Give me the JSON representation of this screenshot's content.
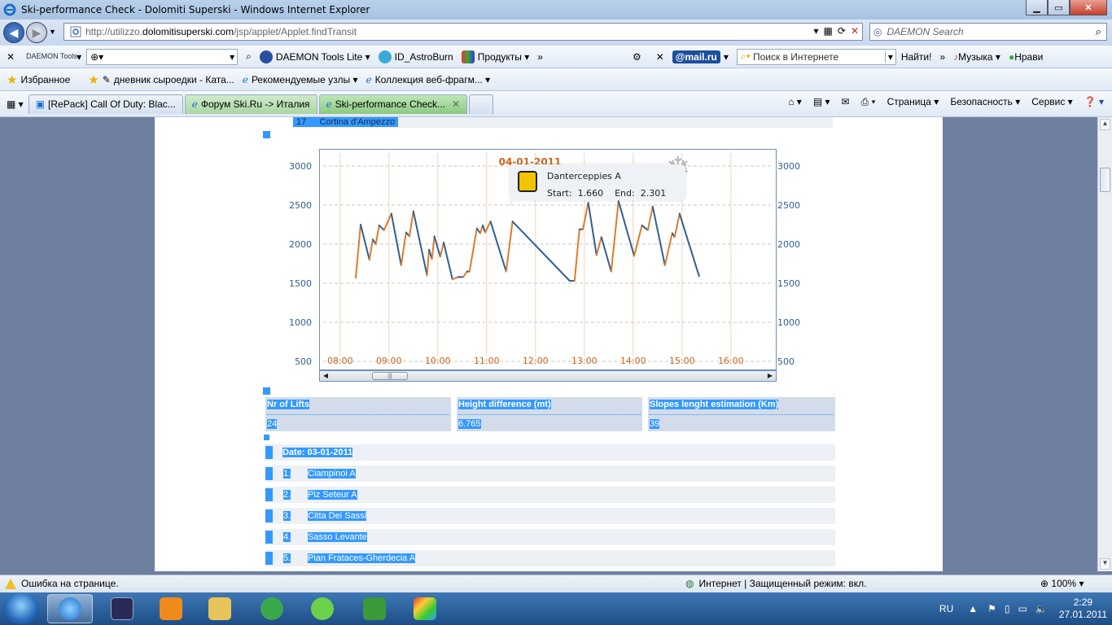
{
  "window": {
    "title": "Ski-performance Check - Dolomiti Superski - Windows Internet Explorer"
  },
  "address": {
    "url_prefix": "http://utilizzo.",
    "url_domain": "dolomitisuperski.com",
    "url_path": "/jsp/applet/Applet.findTransit",
    "search_placeholder": "DAEMON Search"
  },
  "toolbar1": {
    "daemon_logo": "DAEMON Tools",
    "daemon_lite": "DAEMON Tools Lite",
    "astroburn": "ID_AstroBurn",
    "products": "Продукты",
    "mailru": "@mail.ru",
    "search_placeholder": "Поиск в Интернете",
    "find": "Найти!",
    "music": "Музыка",
    "like": "Нрави"
  },
  "favbar": {
    "favorites": "Избранное",
    "item1": "дневник сыроедки - Ката...",
    "item2": "Рекомендуемые узлы",
    "item3": "Коллекция веб-фрагм..."
  },
  "tabs": [
    {
      "label": "[RePack] Call Of Duty: Blac..."
    },
    {
      "label": "Форум Ski.Ru -> Италия"
    },
    {
      "label": "Ski-performance Check..."
    }
  ],
  "commandbar": {
    "page": "Страница",
    "safety": "Безопасность",
    "tools": "Сервис"
  },
  "page": {
    "top_item_num": "17",
    "top_item_name": "Cortina d'Ampezzo",
    "stats": [
      {
        "label": "Nr of Lifts",
        "value": "24"
      },
      {
        "label": "Height difference (mt)",
        "value": "6.765"
      },
      {
        "label": "Slopes lenght estimation (Km)",
        "value": "39"
      }
    ],
    "date_label": "Date: 03-01-2011",
    "lifts": [
      {
        "num": "1.",
        "name": "Ciampinoi A"
      },
      {
        "num": "2.",
        "name": "Piz Seteur A"
      },
      {
        "num": "3.",
        "name": "Citta Dei Sassi"
      },
      {
        "num": "4.",
        "name": "Sasso Levante"
      },
      {
        "num": "5.",
        "name": "Pian Frataces-Gherdecia A"
      }
    ]
  },
  "tooltip": {
    "name": "Danterceppies A",
    "start_label": "Start:",
    "start": "1.660",
    "end_label": "End:",
    "end": "2.301"
  },
  "chart_data": {
    "type": "line",
    "title": "04-01-2011",
    "ylim": [
      500,
      3000
    ],
    "yticks": [
      "3000",
      "2500",
      "2000",
      "1500",
      "1000",
      "500"
    ],
    "xticks": [
      "08:00",
      "09:00",
      "10:00",
      "11:00",
      "12:00",
      "13:00",
      "14:00",
      "15:00",
      "16:00"
    ],
    "xlim_hours": [
      7.92,
      16.7
    ],
    "grid": true,
    "colors": {
      "ascent": "#e07b2a",
      "descent": "#2e5f94",
      "title": "#d0641a",
      "ytick": "#2e5f94",
      "xtick": "#d0641a"
    },
    "points": [
      [
        8.52,
        1570
      ],
      [
        8.62,
        2250
      ],
      [
        8.8,
        1800
      ],
      [
        8.87,
        2060
      ],
      [
        8.93,
        2000
      ],
      [
        9.0,
        2240
      ],
      [
        9.1,
        2180
      ],
      [
        9.25,
        2390
      ],
      [
        9.45,
        1730
      ],
      [
        9.55,
        2150
      ],
      [
        9.62,
        2100
      ],
      [
        9.7,
        2420
      ],
      [
        9.98,
        1600
      ],
      [
        10.02,
        1930
      ],
      [
        10.08,
        1810
      ],
      [
        10.13,
        2100
      ],
      [
        10.25,
        1840
      ],
      [
        10.32,
        2020
      ],
      [
        10.5,
        1550
      ],
      [
        10.62,
        1580
      ],
      [
        10.72,
        1580
      ],
      [
        10.8,
        1650
      ],
      [
        10.85,
        1650
      ],
      [
        11.0,
        2200
      ],
      [
        11.07,
        2140
      ],
      [
        11.12,
        2240
      ],
      [
        11.17,
        2150
      ],
      [
        11.28,
        2290
      ],
      [
        11.6,
        1650
      ],
      [
        11.73,
        2290
      ],
      [
        12.9,
        1530
      ],
      [
        13.0,
        1530
      ],
      [
        13.1,
        2190
      ],
      [
        13.17,
        2190
      ],
      [
        13.28,
        2530
      ],
      [
        13.45,
        1860
      ],
      [
        13.55,
        2090
      ],
      [
        13.75,
        1650
      ],
      [
        13.9,
        2550
      ],
      [
        14.22,
        1850
      ],
      [
        14.38,
        2240
      ],
      [
        14.5,
        2180
      ],
      [
        14.6,
        2480
      ],
      [
        14.85,
        1730
      ],
      [
        15.0,
        2140
      ],
      [
        15.05,
        2090
      ],
      [
        15.15,
        2390
      ],
      [
        15.55,
        1590
      ]
    ]
  },
  "statusbar": {
    "error": "Ошибка на странице.",
    "zone": "Интернет | Защищенный режим: вкл.",
    "zoom": "100%"
  },
  "taskbar": {
    "lang": "RU",
    "time": "2:29",
    "date": "27.01.2011"
  }
}
